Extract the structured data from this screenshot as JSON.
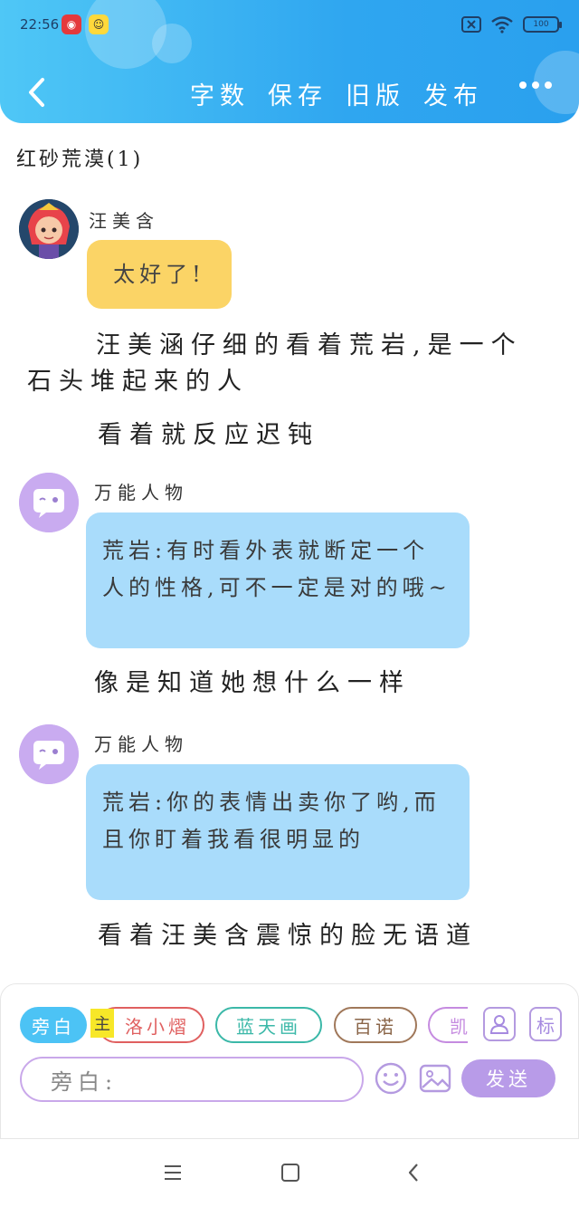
{
  "status": {
    "time": "22:56",
    "battery": "100"
  },
  "nav": {
    "actions": [
      "字数",
      "保存",
      "旧版",
      "发布"
    ]
  },
  "story": {
    "title": "红砂荒漠(1)"
  },
  "messages": [
    {
      "name": "汪美含",
      "text": "太好了!"
    },
    {
      "narration": "汪美涵仔细的看着荒岩,是一个石头堆起来的人"
    },
    {
      "narration": "看着就反应迟钝"
    },
    {
      "name": "万能人物",
      "text": "荒岩:有时看外表就断定一个人的性格,可不一定是对的哦~"
    },
    {
      "narration": "像是知道她想什么一样"
    },
    {
      "name": "万能人物",
      "text": "荒岩:你的表情出卖你了哟,而且你盯着我看很明显的"
    },
    {
      "narration": "看着汪美含震惊的脸无语道"
    }
  ],
  "composer": {
    "chips": [
      "旁白",
      "洛小熠",
      "蓝天画",
      "百诺",
      "凯"
    ],
    "badge": "主",
    "tag_icon_label": "标",
    "input_placeholder": "旁白:",
    "send_label": "发送"
  },
  "colors": {
    "header": "#2fa6f0",
    "yellow_bubble": "#fbd466",
    "blue_bubble": "#a9dcfb",
    "purple": "#b89be8",
    "chip_narration": "#4cc3f5",
    "chip_luo": "#e06060",
    "chip_lan": "#3bb8a8",
    "chip_bainuo": "#a0785a",
    "chip_kai": "#c58be0"
  }
}
